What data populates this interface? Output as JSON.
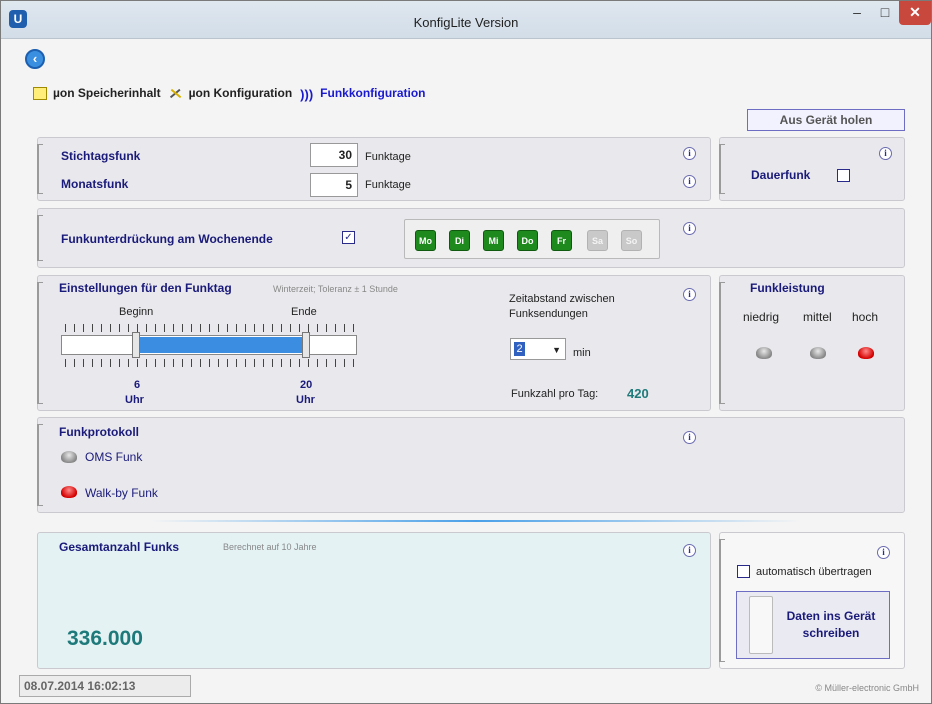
{
  "window": {
    "app_icon": "U",
    "title": "KonfigLite   Version",
    "minimize": "–",
    "maximize": "□",
    "close": "✕"
  },
  "nav": {
    "back_label": "‹"
  },
  "breadcrumb": [
    {
      "label": "µon Speicherinhalt",
      "icon": "memory-icon"
    },
    {
      "label": "µon Konfiguration",
      "icon": "tools-icon"
    },
    {
      "label": "Funkkonfiguration",
      "icon": "radio-waves-icon"
    }
  ],
  "fetch_button": "Aus Gerät holen",
  "stichtag": {
    "label": "Stichtagsfunk",
    "value": "30",
    "unit": "Funktage"
  },
  "monat": {
    "label": "Monatsfunk",
    "value": "5",
    "unit": "Funktage"
  },
  "dauerfunk": {
    "label": "Dauerfunk",
    "checked": false
  },
  "weekend": {
    "label": "Funkunterdrückung am Wochenende",
    "checked": true
  },
  "days": [
    {
      "label": "Mo",
      "active": true
    },
    {
      "label": "Di",
      "active": true
    },
    {
      "label": "Mi",
      "active": true
    },
    {
      "label": "Do",
      "active": true
    },
    {
      "label": "Fr",
      "active": true
    },
    {
      "label": "Sa",
      "active": false
    },
    {
      "label": "So",
      "active": false
    }
  ],
  "funktag": {
    "title": "Einstellungen für den Funktag",
    "note": "Winterzeit; Toleranz ± 1 Stunde",
    "begin_label": "Beginn",
    "end_label": "Ende",
    "begin_value": "6",
    "end_value": "20",
    "unit": "Uhr",
    "interval_label_1": "Zeitabstand zwischen",
    "interval_label_2": "Funksendungen",
    "interval_value": "2",
    "interval_unit": "min",
    "count_label": "Funkzahl pro Tag:",
    "count_value": "420"
  },
  "leistung": {
    "title": "Funkleistung",
    "levels": [
      "niedrig",
      "mittel",
      "hoch"
    ],
    "active": "hoch"
  },
  "protokoll": {
    "title": "Funkprotokoll",
    "items": [
      {
        "label": "OMS Funk",
        "active": false
      },
      {
        "label": "Walk-by Funk",
        "active": true
      }
    ]
  },
  "total": {
    "title": "Gesamtanzahl Funks",
    "note": "Berechnet auf 10 Jahre",
    "value": "336.000"
  },
  "transfer": {
    "auto_label": "automatisch übertragen",
    "auto_checked": false,
    "write_label_1": "Daten ins Gerät",
    "write_label_2": "schreiben"
  },
  "status": {
    "datetime": "08.07.2014 16:02:13",
    "copyright": "© Müller-electronic GmbH"
  },
  "info_glyph": "i",
  "colors": {
    "day_active": "#1e8a1e",
    "day_inactive": "#c9c9c9",
    "accent_blue": "#1a1ad0",
    "total_value": "#1e7a7a",
    "led_on": "#d40000"
  }
}
